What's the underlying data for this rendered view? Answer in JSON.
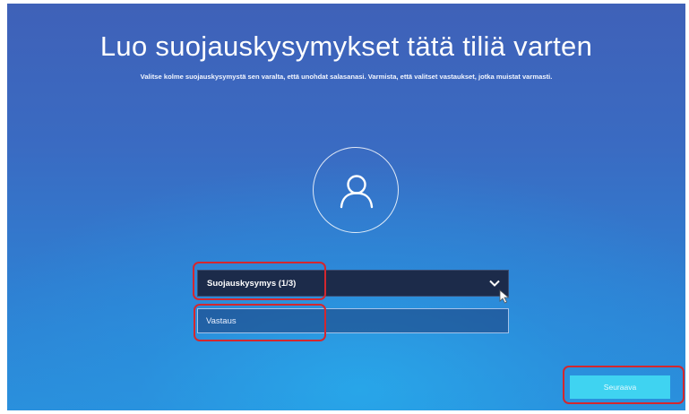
{
  "page": {
    "title": "Luo suojauskysymykset tätä tiliä varten",
    "subtitle": "Valitse kolme suojauskysymystä sen varalta, että unohdat salasanasi. Varmista, että valitset vastaukset, jotka muistat varmasti."
  },
  "form": {
    "question_dropdown": {
      "selected": "Suojauskysymys (1/3)"
    },
    "answer_field": {
      "placeholder": "Vastaus",
      "value": ""
    },
    "next_label": "Seuraava"
  },
  "icons": {
    "avatar": "user-avatar-icon",
    "dropdown": "chevron-down-icon",
    "cursor": "mouse-cursor-icon"
  },
  "colors": {
    "next_button": "#3fd3f1",
    "dropdown_bg": "#1c2b4a",
    "highlight": "#d4272e"
  }
}
